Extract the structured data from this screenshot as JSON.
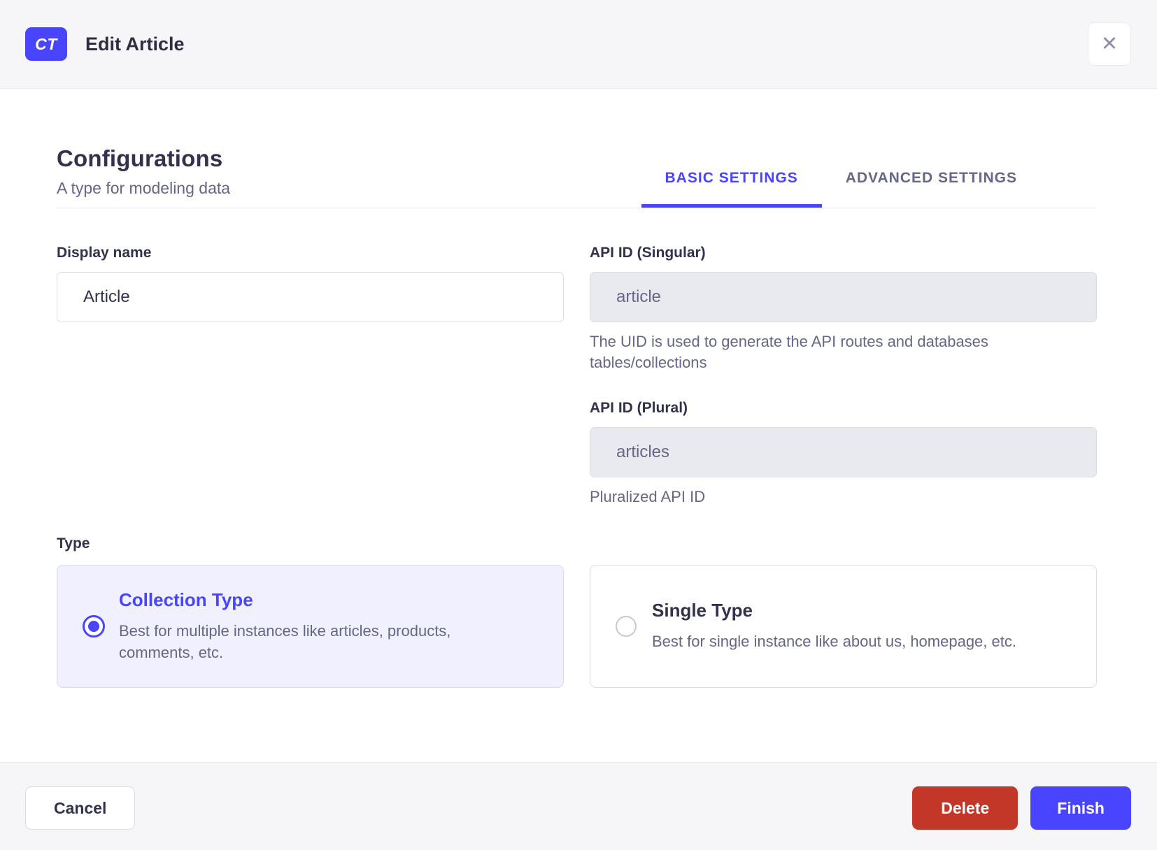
{
  "header": {
    "badge": "CT",
    "title": "Edit Article",
    "close_icon": "✕"
  },
  "section": {
    "title": "Configurations",
    "subtitle": "A type for modeling data"
  },
  "tabs": [
    {
      "label": "BASIC SETTINGS",
      "active": true
    },
    {
      "label": "ADVANCED SETTINGS",
      "active": false
    }
  ],
  "form": {
    "display_name": {
      "label": "Display name",
      "value": "Article"
    },
    "api_id_singular": {
      "label": "API ID (Singular)",
      "value": "article",
      "hint": "The UID is used to generate the API routes and databases tables/collections"
    },
    "api_id_plural": {
      "label": "API ID (Plural)",
      "value": "articles",
      "hint": "Pluralized API ID"
    },
    "type": {
      "label": "Type",
      "options": [
        {
          "title": "Collection Type",
          "description": "Best for multiple instances like articles, products, comments, etc.",
          "selected": true
        },
        {
          "title": "Single Type",
          "description": "Best for single instance like about us, homepage, etc.",
          "selected": false
        }
      ]
    }
  },
  "footer": {
    "cancel_label": "Cancel",
    "delete_label": "Delete",
    "finish_label": "Finish"
  },
  "colors": {
    "primary": "#4945ff",
    "danger": "#c23728",
    "selected_card_bg": "#f0f0ff",
    "chrome_bg": "#f6f6f9",
    "text_dark": "#32324d",
    "text_muted": "#666687"
  }
}
